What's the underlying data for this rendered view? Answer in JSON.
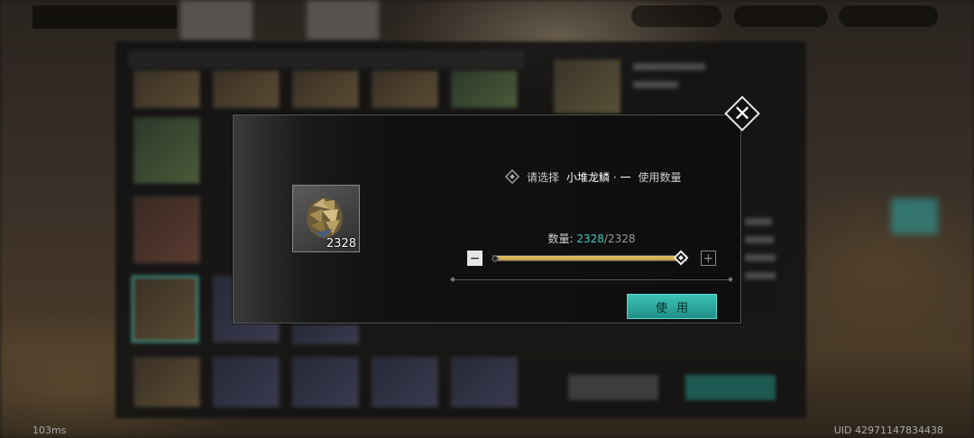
{
  "dialog": {
    "prompt_prefix": "请选择",
    "item_name": "小堆龙鳞 · 一",
    "prompt_suffix": "使用数量",
    "item_count": "2328",
    "qty_label": "数量:",
    "qty_current": "2328",
    "qty_separator": "/",
    "qty_max": "2328",
    "quantity_fraction": 1.0,
    "minus_label": "−",
    "plus_label": "+",
    "use_button_label": "使用",
    "close_label": "✕"
  },
  "footer": {
    "latency": "103ms",
    "uid": "UID 42971147834438"
  },
  "colors": {
    "accent_teal": "#3cc2b6",
    "slider_gold": "#e7c86a"
  }
}
